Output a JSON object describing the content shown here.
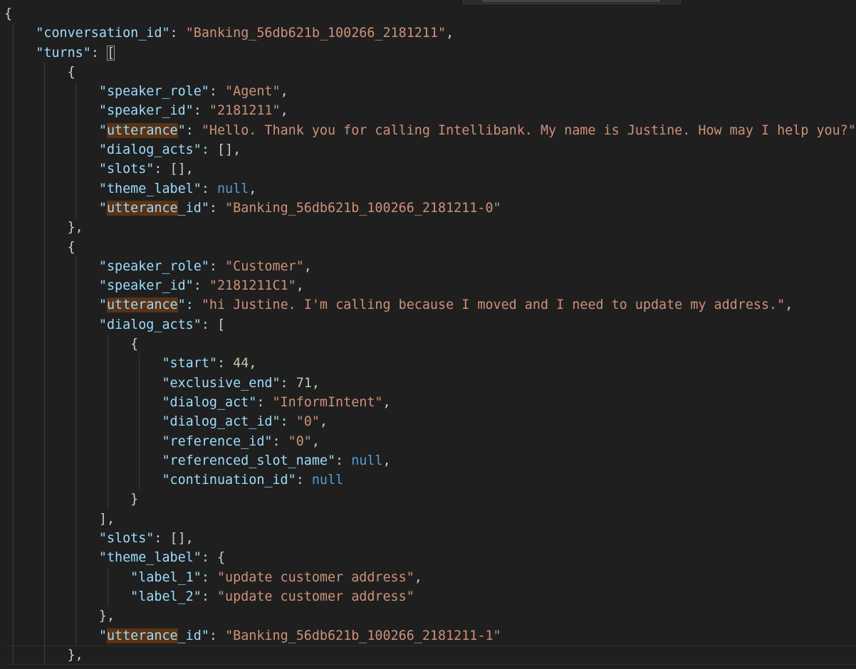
{
  "editor": {
    "colors": {
      "background": "#1f1f1f",
      "punctuation": "#cccccc",
      "key": "#9cdcfe",
      "string": "#ce9178",
      "number": "#b5cea8",
      "null": "#569cd6",
      "match_highlight": "#5a3214",
      "indent_guide": "#3c3c3c"
    },
    "lines": [
      {
        "indent": 0,
        "tokens": [
          {
            "t": "{",
            "k": "punct"
          }
        ]
      },
      {
        "indent": 1,
        "tokens": [
          {
            "t": "\"conversation_id\"",
            "k": "key"
          },
          {
            "t": ": ",
            "k": "punct"
          },
          {
            "t": "\"Banking_56db621b_100266_2181211\"",
            "k": "str"
          },
          {
            "t": ",",
            "k": "punct"
          }
        ]
      },
      {
        "indent": 1,
        "tokens": [
          {
            "t": "\"turns\"",
            "k": "key"
          },
          {
            "t": ": ",
            "k": "punct"
          },
          {
            "t": "[",
            "k": "bracket"
          }
        ]
      },
      {
        "indent": 2,
        "tokens": [
          {
            "t": "{",
            "k": "punct"
          }
        ]
      },
      {
        "indent": 3,
        "tokens": [
          {
            "t": "\"speaker_role\"",
            "k": "key"
          },
          {
            "t": ": ",
            "k": "punct"
          },
          {
            "t": "\"Agent\"",
            "k": "str"
          },
          {
            "t": ",",
            "k": "punct"
          }
        ]
      },
      {
        "indent": 3,
        "tokens": [
          {
            "t": "\"speaker_id\"",
            "k": "key"
          },
          {
            "t": ": ",
            "k": "punct"
          },
          {
            "t": "\"2181211\"",
            "k": "str"
          },
          {
            "t": ",",
            "k": "punct"
          }
        ]
      },
      {
        "indent": 3,
        "tokens": [
          {
            "t": "\"",
            "k": "key"
          },
          {
            "t": "utterance",
            "k": "key-hl"
          },
          {
            "t": "\"",
            "k": "key"
          },
          {
            "t": ": ",
            "k": "punct"
          },
          {
            "t": "\"Hello. Thank you for calling Intellibank. My name is Justine. How may I help you?\"",
            "k": "str"
          },
          {
            "t": ",",
            "k": "punct"
          }
        ]
      },
      {
        "indent": 3,
        "tokens": [
          {
            "t": "\"dialog_acts\"",
            "k": "key"
          },
          {
            "t": ": [],",
            "k": "punct"
          }
        ]
      },
      {
        "indent": 3,
        "tokens": [
          {
            "t": "\"slots\"",
            "k": "key"
          },
          {
            "t": ": [],",
            "k": "punct"
          }
        ]
      },
      {
        "indent": 3,
        "tokens": [
          {
            "t": "\"theme_label\"",
            "k": "key"
          },
          {
            "t": ": ",
            "k": "punct"
          },
          {
            "t": "null",
            "k": "null"
          },
          {
            "t": ",",
            "k": "punct"
          }
        ]
      },
      {
        "indent": 3,
        "tokens": [
          {
            "t": "\"",
            "k": "key"
          },
          {
            "t": "utterance",
            "k": "key-hl"
          },
          {
            "t": "_id\"",
            "k": "key"
          },
          {
            "t": ": ",
            "k": "punct"
          },
          {
            "t": "\"Banking_56db621b_100266_2181211-0\"",
            "k": "str"
          }
        ]
      },
      {
        "indent": 2,
        "tokens": [
          {
            "t": "},",
            "k": "punct"
          }
        ]
      },
      {
        "indent": 2,
        "tokens": [
          {
            "t": "{",
            "k": "punct"
          }
        ]
      },
      {
        "indent": 3,
        "tokens": [
          {
            "t": "\"speaker_role\"",
            "k": "key"
          },
          {
            "t": ": ",
            "k": "punct"
          },
          {
            "t": "\"Customer\"",
            "k": "str"
          },
          {
            "t": ",",
            "k": "punct"
          }
        ]
      },
      {
        "indent": 3,
        "tokens": [
          {
            "t": "\"speaker_id\"",
            "k": "key"
          },
          {
            "t": ": ",
            "k": "punct"
          },
          {
            "t": "\"2181211C1\"",
            "k": "str"
          },
          {
            "t": ",",
            "k": "punct"
          }
        ]
      },
      {
        "indent": 3,
        "tokens": [
          {
            "t": "\"",
            "k": "key"
          },
          {
            "t": "utterance",
            "k": "key-hl"
          },
          {
            "t": "\"",
            "k": "key"
          },
          {
            "t": ": ",
            "k": "punct"
          },
          {
            "t": "\"hi Justine. I'm calling because I moved and I need to update my address.\"",
            "k": "str"
          },
          {
            "t": ",",
            "k": "punct"
          }
        ]
      },
      {
        "indent": 3,
        "tokens": [
          {
            "t": "\"dialog_acts\"",
            "k": "key"
          },
          {
            "t": ": [",
            "k": "punct"
          }
        ]
      },
      {
        "indent": 4,
        "tokens": [
          {
            "t": "{",
            "k": "punct"
          }
        ]
      },
      {
        "indent": 5,
        "tokens": [
          {
            "t": "\"start\"",
            "k": "key"
          },
          {
            "t": ": ",
            "k": "punct"
          },
          {
            "t": "44",
            "k": "num"
          },
          {
            "t": ",",
            "k": "punct"
          }
        ]
      },
      {
        "indent": 5,
        "tokens": [
          {
            "t": "\"exclusive_end\"",
            "k": "key"
          },
          {
            "t": ": ",
            "k": "punct"
          },
          {
            "t": "71",
            "k": "num"
          },
          {
            "t": ",",
            "k": "punct"
          }
        ]
      },
      {
        "indent": 5,
        "tokens": [
          {
            "t": "\"dialog_act\"",
            "k": "key"
          },
          {
            "t": ": ",
            "k": "punct"
          },
          {
            "t": "\"InformIntent\"",
            "k": "str"
          },
          {
            "t": ",",
            "k": "punct"
          }
        ]
      },
      {
        "indent": 5,
        "tokens": [
          {
            "t": "\"dialog_act_id\"",
            "k": "key"
          },
          {
            "t": ": ",
            "k": "punct"
          },
          {
            "t": "\"0\"",
            "k": "str"
          },
          {
            "t": ",",
            "k": "punct"
          }
        ]
      },
      {
        "indent": 5,
        "tokens": [
          {
            "t": "\"reference_id\"",
            "k": "key"
          },
          {
            "t": ": ",
            "k": "punct"
          },
          {
            "t": "\"0\"",
            "k": "str"
          },
          {
            "t": ",",
            "k": "punct"
          }
        ]
      },
      {
        "indent": 5,
        "tokens": [
          {
            "t": "\"referenced_slot_name\"",
            "k": "key"
          },
          {
            "t": ": ",
            "k": "punct"
          },
          {
            "t": "null",
            "k": "null"
          },
          {
            "t": ",",
            "k": "punct"
          }
        ]
      },
      {
        "indent": 5,
        "tokens": [
          {
            "t": "\"continuation_id\"",
            "k": "key"
          },
          {
            "t": ": ",
            "k": "punct"
          },
          {
            "t": "null",
            "k": "null"
          }
        ]
      },
      {
        "indent": 4,
        "tokens": [
          {
            "t": "}",
            "k": "punct"
          }
        ]
      },
      {
        "indent": 3,
        "tokens": [
          {
            "t": "],",
            "k": "punct"
          }
        ]
      },
      {
        "indent": 3,
        "tokens": [
          {
            "t": "\"slots\"",
            "k": "key"
          },
          {
            "t": ": [],",
            "k": "punct"
          }
        ]
      },
      {
        "indent": 3,
        "tokens": [
          {
            "t": "\"theme_label\"",
            "k": "key"
          },
          {
            "t": ": {",
            "k": "punct"
          }
        ]
      },
      {
        "indent": 4,
        "tokens": [
          {
            "t": "\"label_1\"",
            "k": "key"
          },
          {
            "t": ": ",
            "k": "punct"
          },
          {
            "t": "\"update customer address\"",
            "k": "str"
          },
          {
            "t": ",",
            "k": "punct"
          }
        ]
      },
      {
        "indent": 4,
        "tokens": [
          {
            "t": "\"label_2\"",
            "k": "key"
          },
          {
            "t": ": ",
            "k": "punct"
          },
          {
            "t": "\"update customer address\"",
            "k": "str"
          }
        ]
      },
      {
        "indent": 3,
        "tokens": [
          {
            "t": "},",
            "k": "punct"
          }
        ]
      },
      {
        "indent": 3,
        "tokens": [
          {
            "t": "\"",
            "k": "key"
          },
          {
            "t": "utterance",
            "k": "key-hl"
          },
          {
            "t": "_id\"",
            "k": "key"
          },
          {
            "t": ": ",
            "k": "punct"
          },
          {
            "t": "\"Banking_56db621b_100266_2181211-1\"",
            "k": "str"
          }
        ]
      },
      {
        "indent": 2,
        "tokens": [
          {
            "t": "},",
            "k": "punct"
          }
        ]
      }
    ]
  }
}
